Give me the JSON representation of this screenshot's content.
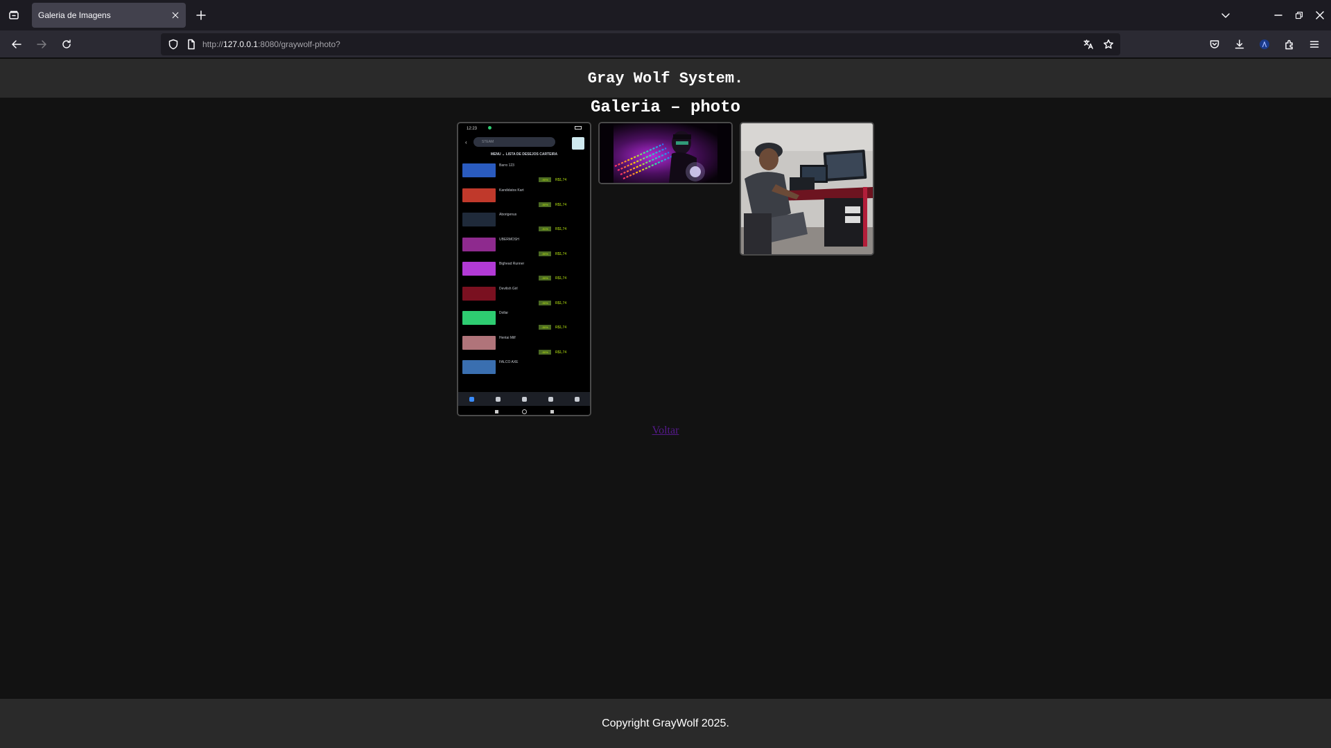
{
  "browser": {
    "tab_title": "Galeria de Imagens",
    "url_prefix": "http://",
    "url_host": "127.0.0.1",
    "url_rest": ":8080/graywolf-photo?"
  },
  "page": {
    "site_title": "Gray Wolf System.",
    "gallery_title": "Galeria – photo",
    "back_link": "Voltar",
    "copyright": "Copyright GrayWolf 2025."
  },
  "photos": [
    {
      "kind": "phone-screenshot",
      "status_time": "12:23",
      "search_placeholder": "STEAM",
      "menu_tabs": "MENU ⌄     LISTA DE DESEJOS     CARTEIRA",
      "games": [
        {
          "name": "Barro 123",
          "discount": "-90%",
          "price": "R$1,74",
          "color": "#2a5bbf"
        },
        {
          "name": "Kandidatos Kart",
          "discount": "-50%",
          "price": "R$1,74",
          "color": "#c0392b"
        },
        {
          "name": "Aborigenus",
          "discount": "-91%",
          "price": "R$1,74",
          "color": "#1f2a3a"
        },
        {
          "name": "UBERMOSH",
          "discount": "-50%",
          "price": "R$1,74",
          "color": "#8e2a8e"
        },
        {
          "name": "Bighead Runner",
          "discount": "-90%",
          "price": "R$1,74",
          "color": "#b23ad6"
        },
        {
          "name": "Devilish Girl",
          "discount": "-90%",
          "price": "R$1,74",
          "color": "#7a1020"
        },
        {
          "name": "Dollar",
          "discount": "-50%",
          "price": "R$1,74",
          "color": "#2ecc71"
        },
        {
          "name": "Hentai Milf",
          "discount": "-50%",
          "price": "R$1,74",
          "color": "#b0747a"
        },
        {
          "name": "FALCO AXE",
          "discount": "",
          "price": "",
          "color": "#3a6fb0"
        }
      ]
    },
    {
      "kind": "keyboard-rgb-photo"
    },
    {
      "kind": "person-at-desk-photo"
    }
  ],
  "colors": {
    "header_bg": "#2a2a2a",
    "page_bg": "#121212",
    "link_visited": "#551a8b",
    "steam_green": "#beee11"
  }
}
